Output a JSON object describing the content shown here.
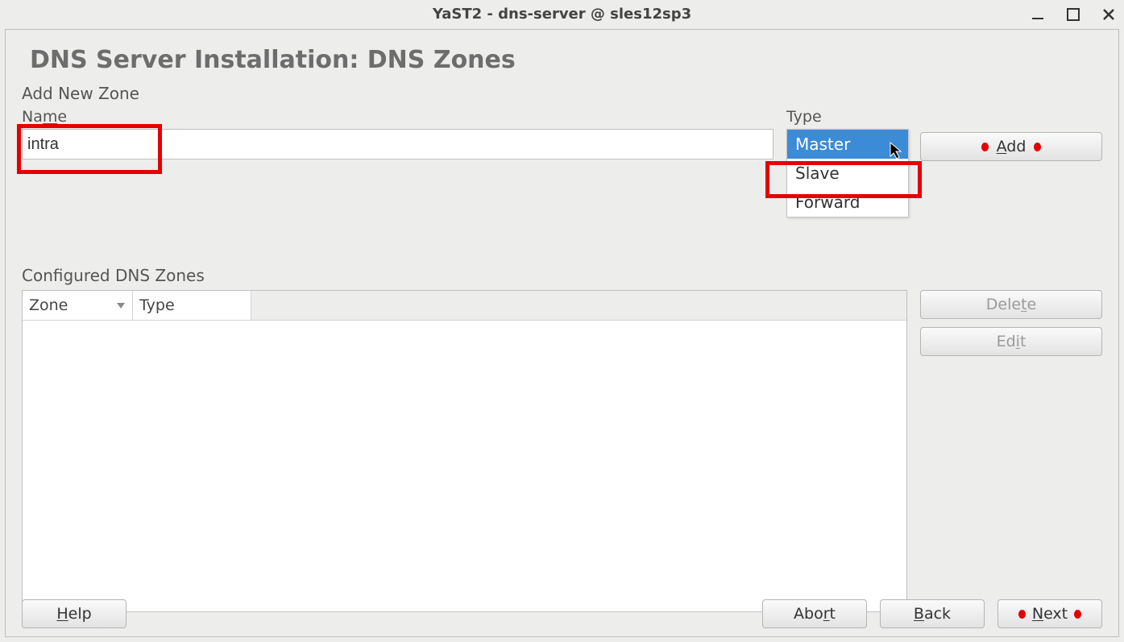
{
  "window": {
    "title": "YaST2 - dns-server @ sles12sp3"
  },
  "page": {
    "heading": "DNS Server Installation: DNS Zones",
    "add_section": "Add New Zone",
    "name_label_pre": "Na",
    "name_label_u": "m",
    "name_label_post": "e",
    "name_value": "intra",
    "type_label": "Type",
    "type_options": [
      "Master",
      "Slave",
      "Forward"
    ],
    "type_selected_index": 0,
    "add_btn_u": "A",
    "add_btn_post": "dd",
    "configured_label": "Configured DNS Zones",
    "columns": {
      "zone": "Zone",
      "type": "Type"
    },
    "delete_btn_pre": "Dele",
    "delete_btn_u": "t",
    "delete_btn_post": "e",
    "edit_btn_pre": "Ed",
    "edit_btn_u": "i",
    "edit_btn_post": "t"
  },
  "footer": {
    "help_u": "H",
    "help_post": "elp",
    "abort_pre": "Abo",
    "abort_u": "r",
    "abort_post": "t",
    "back_u": "B",
    "back_post": "ack",
    "next_u": "N",
    "next_post": "ext"
  }
}
